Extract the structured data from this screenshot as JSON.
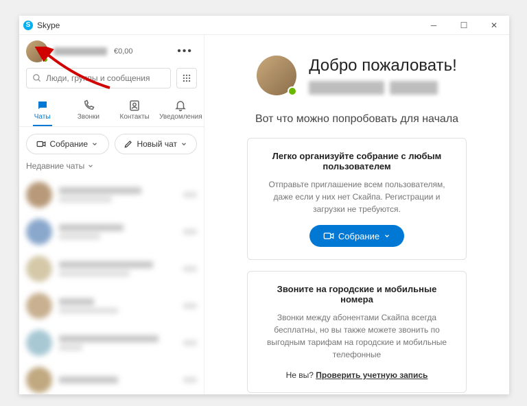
{
  "titlebar": {
    "title": "Skype"
  },
  "profile": {
    "credit": "€0,00"
  },
  "search": {
    "placeholder": "Люди, группы и сообщения"
  },
  "tabs": {
    "chats": "Чаты",
    "calls": "Звонки",
    "contacts": "Контакты",
    "notifications": "Уведомления"
  },
  "actions": {
    "meeting": "Собрание",
    "new_chat": "Новый чат"
  },
  "recent_header": "Недавние чаты",
  "welcome": {
    "title": "Добро пожаловать!",
    "subheading": "Вот что можно попробовать для начала"
  },
  "card1": {
    "title": "Легко организуйте собрание с любым пользователем",
    "body": "Отправьте приглашение всем пользователям, даже если у них нет Скайпа. Регистрации и загрузки не требуются.",
    "button": "Собрание"
  },
  "card2": {
    "title": "Звоните на городские и мобильные номера",
    "body": "Звонки между абонентами Скайпа всегда бесплатны, но вы также можете звонить по выгодным тарифам на городские и мобильные телефонные",
    "notyou": "Не вы?",
    "link": "Проверить учетную запись"
  }
}
